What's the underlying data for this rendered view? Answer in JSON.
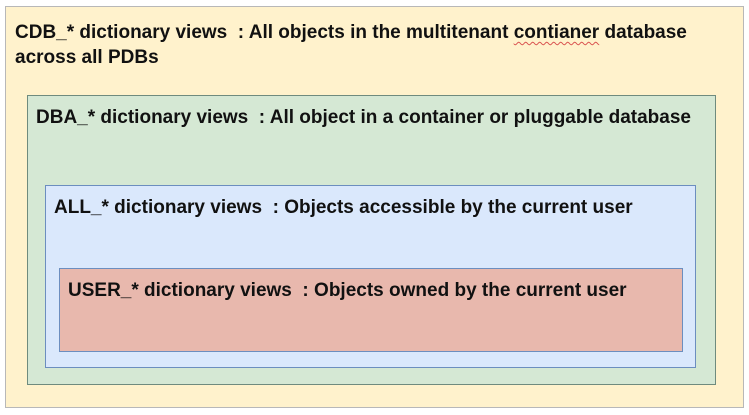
{
  "boxes": {
    "cdb": {
      "name": "CDB_* dictionary views",
      "separator": "  : ",
      "description_before": "All objects in the multitenant ",
      "misspelled": "contianer",
      "description_after": " database across all PDBs",
      "fill": "#fff2cc"
    },
    "dba": {
      "name": "DBA_* dictionary views",
      "separator": "  : ",
      "description": "All object in a container or pluggable database",
      "fill": "#d5e8d4"
    },
    "all": {
      "name": "ALL_* dictionary views",
      "separator": "  : ",
      "description": "Objects accessible by the current user",
      "fill": "#dae8fc"
    },
    "user": {
      "name": "USER_* dictionary views",
      "separator": "  : ",
      "description": "Objects owned by the current user",
      "fill": "#e8b8ad"
    }
  }
}
